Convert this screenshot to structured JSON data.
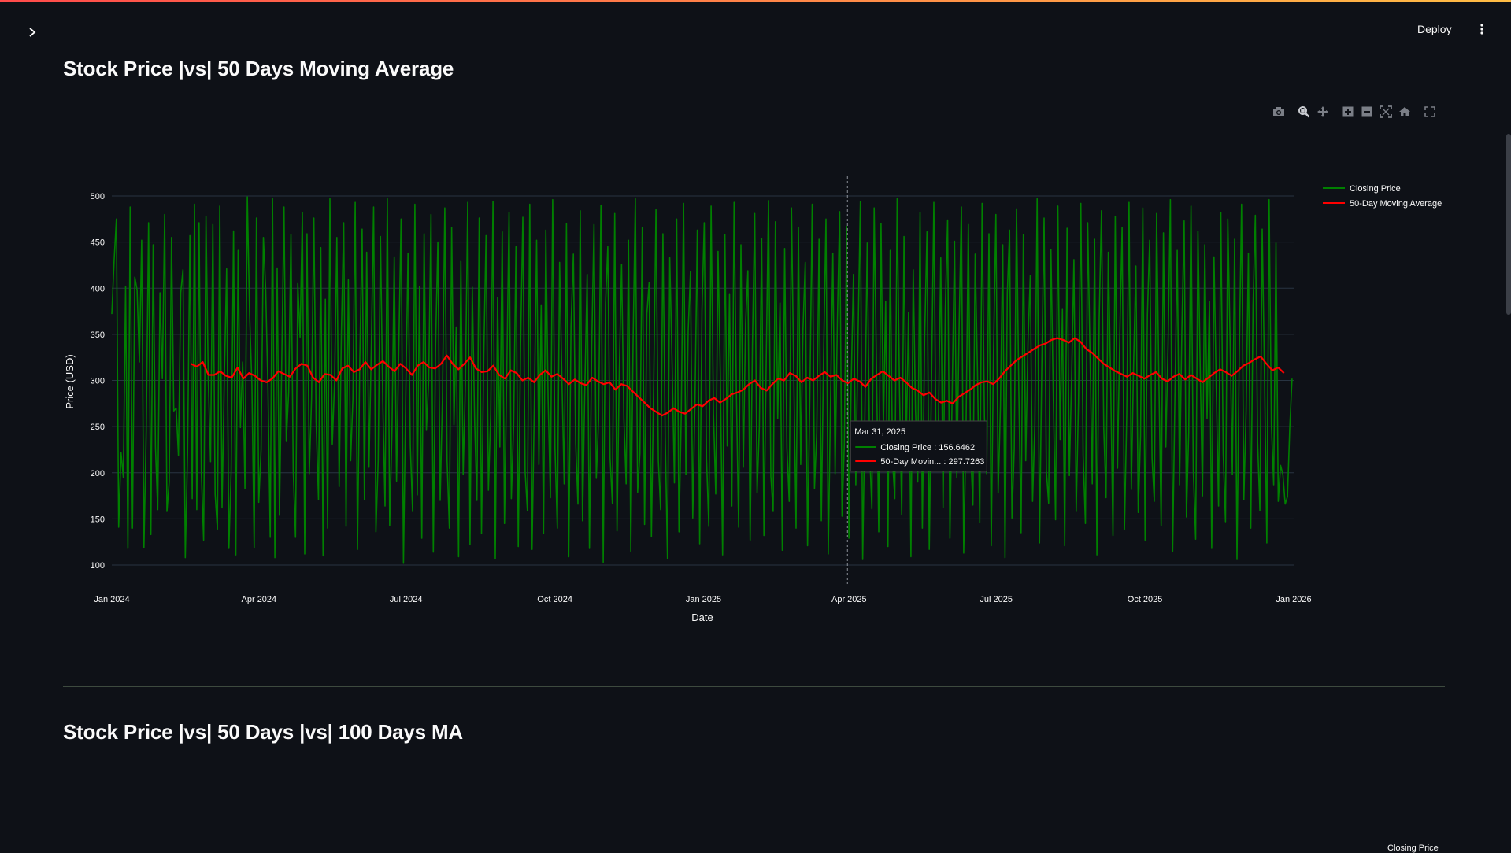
{
  "header": {
    "deploy_label": "Deploy",
    "sidebar_toggle_icon": "chevron-right-icon",
    "menu_icon": "vertical-dots-icon"
  },
  "section1": {
    "title": "Stock Price |vs| 50 Days Moving Average"
  },
  "section2": {
    "title": "Stock Price |vs| 50 Days |vs| 100 Days MA",
    "legend_partial": "Closing Price"
  },
  "modebar": {
    "icons": [
      "camera-icon",
      "zoom-icon",
      "pan-icon",
      "zoom-in-icon",
      "zoom-out-icon",
      "autoscale-icon",
      "home-icon",
      "fullscreen-icon"
    ]
  },
  "colors": {
    "background": "#0e1117",
    "closing": "#008000",
    "ma": "#ff0000",
    "accent": "#ff4b4b"
  },
  "chart_data": {
    "type": "line",
    "xlabel": "Date",
    "ylabel": "Price (USD)",
    "ylim": [
      100,
      500
    ],
    "yticks": [
      100,
      150,
      200,
      250,
      300,
      350,
      400,
      450,
      500
    ],
    "xrange": [
      "2024-01-01",
      "2026-01-01"
    ],
    "xtick_labels": [
      "Jan 2024",
      "Apr 2024",
      "Jul 2024",
      "Oct 2024",
      "Jan 2025",
      "Apr 2025",
      "Jul 2025",
      "Oct 2025",
      "Jan 2026"
    ],
    "xtick_dates": [
      "2024-01-01",
      "2024-04-01",
      "2024-07-01",
      "2024-10-01",
      "2025-01-01",
      "2025-04-01",
      "2025-07-01",
      "2025-10-01",
      "2026-01-01"
    ],
    "grid": true,
    "legend_position": "top-right",
    "series": [
      {
        "name": "Closing Price",
        "color": "#008000",
        "note": "daily random values between 100 and 500",
        "x_start": "2024-01-01",
        "values": [
          372,
          430,
          475,
          141,
          222,
          195,
          402,
          118,
          488,
          140,
          412,
          398,
          320,
          452,
          119,
          245,
          471,
          133,
          447,
          228,
          160,
          395,
          302,
          480,
          158,
          190,
          455,
          267,
          270,
          219,
          395,
          420,
          108,
          222,
          457,
          172,
          491,
          160,
          471,
          201,
          127,
          478,
          301,
          212,
          469,
          177,
          139,
          489,
          162,
          303,
          421,
          118,
          202,
          462,
          111,
          441,
          249,
          320,
          183,
          499,
          372,
          296,
          119,
          476,
          168,
          225,
          455,
          399,
          292,
          130,
          497,
          108,
          422,
          154,
          319,
          488,
          234,
          287,
          458,
          203,
          130,
          405,
          347,
          482,
          112,
          459,
          199,
          281,
          476,
          255,
          171,
          444,
          110,
          388,
          140,
          497,
          231,
          298,
          455,
          185,
          353,
          471,
          142,
          409,
          213,
          280,
          493,
          117,
          324,
          464,
          171,
          439,
          206,
          331,
          488,
          136,
          213,
          456,
          278,
          164,
          497,
          143,
          246,
          434,
          191,
          337,
          475,
          102,
          283,
          438,
          229,
          158,
          491,
          176,
          402,
          129,
          459,
          246,
          299,
          480,
          114,
          338,
          450,
          170,
          281,
          487,
          213,
          140,
          466,
          252,
          358,
          109,
          429,
          198,
          297,
          493,
          122,
          401,
          254,
          170,
          476,
          134,
          328,
          457,
          181,
          264,
          494,
          107,
          390,
          228,
          461,
          145,
          308,
          482,
          172,
          251,
          445,
          120,
          336,
          477,
          201,
          159,
          491,
          117,
          273,
          452,
          209,
          382,
          134,
          463,
          280,
          173,
          496,
          226,
          140,
          428,
          303,
          188,
          470,
          109,
          359,
          437,
          232,
          166,
          484,
          148,
          291,
          415,
          118,
          339,
          469,
          194,
          257,
          490,
          103,
          383,
          445,
          216,
          167,
          481,
          137,
          310,
          426,
          259,
          188,
          452,
          115,
          341,
          497,
          179,
          221,
          466,
          144,
          372,
          406,
          131,
          298,
          485,
          213,
          160,
          459,
          240,
          107,
          433,
          317,
          189,
          475,
          136,
          262,
          492,
          198,
          354,
          418,
          151,
          281,
          463,
          123,
          376,
          471,
          215,
          142,
          489,
          264,
          177,
          440,
          307,
          111,
          458,
          229,
          394,
          164,
          493,
          288,
          141,
          447,
          206,
          362,
          419,
          127,
          339,
          481,
          178,
          250,
          454,
          132,
          321,
          495,
          196,
          158,
          472,
          259,
          384,
          116,
          443,
          227,
          169,
          487,
          305,
          140,
          466,
          209,
          356,
          428,
          121,
          281,
          491,
          183,
          244,
          453,
          148,
          330,
          475,
          112,
          278,
          438,
          199,
          365,
          483,
          153,
          231,
          467,
          129,
          297,
          415,
          187,
          352,
          494,
          106,
          268,
          449,
          224,
          161,
          487,
          316,
          136,
          470,
          249,
          386,
          120,
          441,
          214,
          172,
          497,
          292,
          155,
          456,
          233,
          374,
          109,
          420,
          268,
          190,
          482,
          140,
          346,
          461,
          117,
          302,
          493,
          208,
          255,
          433,
          162,
          379,
          474,
          129,
          287,
          451,
          195,
          358,
          488,
          113,
          241,
          469,
          224,
          165,
          437,
          310,
          146,
          492,
          261,
          199,
          459,
          121,
          332,
          480,
          178,
          273,
          447,
          108,
          394,
          463,
          151,
          226,
          486,
          290,
          135,
          458,
          213,
          342,
          414,
          169,
          253,
          497,
          124,
          315,
          476,
          202,
          167,
          442,
          283,
          149,
          489,
          236,
          377,
          121,
          465,
          197,
          304,
          431,
          158,
          276,
          492,
          219,
          145,
          471,
          331,
          188,
          453,
          111,
          367,
          484,
          248,
          173,
          439,
          296,
          132,
          478,
          205,
          351,
          466,
          139,
          263,
          493,
          182,
          318,
          424,
          157,
          240,
          487,
          127,
          371,
          452,
          216,
          169,
          481,
          299,
          143,
          460,
          228,
          339,
          496,
          115,
          284,
          441,
          187,
          355,
          473,
          152,
          244,
          489,
          203,
          128,
          462,
          312,
          175,
          447,
          259,
          386,
          118,
          434,
          291,
          164,
          482,
          221,
          147,
          475,
          346,
          198,
          453,
          106,
          327,
          491,
          171,
          267,
          438,
          140,
          381,
          479,
          233,
          159,
          464,
          301,
          124,
          496,
          252,
          187,
          449,
          169,
          208,
          198,
          166,
          174,
          248,
          302
        ]
      },
      {
        "name": "50-Day Moving Average",
        "color": "#ff0000",
        "note": "50-day moving average of closing price",
        "x_start": "2024-02-19",
        "values": [
          318,
          315,
          320,
          306,
          306,
          310,
          305,
          303,
          314,
          302,
          308,
          305,
          300,
          298,
          302,
          310,
          307,
          304,
          313,
          318,
          316,
          303,
          298,
          307,
          306,
          300,
          313,
          316,
          309,
          312,
          320,
          312,
          317,
          321,
          315,
          310,
          318,
          313,
          306,
          316,
          320,
          314,
          313,
          318,
          327,
          318,
          312,
          318,
          325,
          313,
          309,
          310,
          316,
          306,
          302,
          311,
          308,
          300,
          303,
          298,
          306,
          311,
          304,
          307,
          302,
          296,
          301,
          297,
          295,
          303,
          299,
          296,
          298,
          290,
          296,
          294,
          288,
          282,
          276,
          270,
          266,
          262,
          265,
          270,
          266,
          264,
          269,
          274,
          272,
          278,
          281,
          276,
          280,
          285,
          287,
          290,
          296,
          300,
          292,
          289,
          296,
          302,
          300,
          308,
          305,
          298,
          303,
          300,
          305,
          309,
          304,
          306,
          300,
          297,
          302,
          299,
          293,
          302,
          306,
          310,
          305,
          300,
          303,
          298,
          292,
          289,
          284,
          287,
          280,
          276,
          278,
          275,
          282,
          286,
          290,
          295,
          298,
          299,
          296,
          302,
          310,
          316,
          322,
          326,
          330,
          334,
          338,
          340,
          344,
          346,
          344,
          341,
          346,
          342,
          334,
          330,
          324,
          318,
          314,
          310,
          307,
          304,
          308,
          305,
          302,
          306,
          309,
          302,
          299,
          304,
          307,
          301,
          306,
          302,
          298,
          303,
          308,
          312,
          309,
          305,
          310,
          316,
          319,
          323,
          326,
          318,
          311,
          314,
          308
        ]
      }
    ],
    "hover": {
      "date_label": "Mar 31, 2025",
      "date": "2025-03-31",
      "closing_label": "Closing Price : 156.6462",
      "ma_label": "50-Day Movin... : 297.7263"
    }
  }
}
